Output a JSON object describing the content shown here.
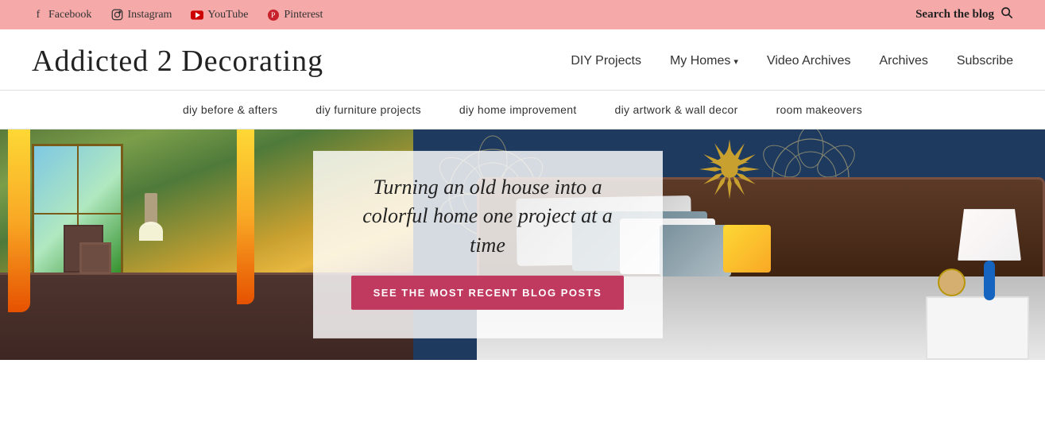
{
  "topbar": {
    "facebook": "Facebook",
    "instagram": "Instagram",
    "youtube": "YouTube",
    "pinterest": "Pinterest",
    "search_label": "Search the blog"
  },
  "header": {
    "logo": "Addicted 2 Decorating",
    "nav": [
      {
        "id": "diy-projects",
        "label": "DIY Projects",
        "has_dropdown": false
      },
      {
        "id": "my-homes",
        "label": "My Homes",
        "has_dropdown": true
      },
      {
        "id": "video-archives",
        "label": "Video Archives",
        "has_dropdown": false
      },
      {
        "id": "archives",
        "label": "Archives",
        "has_dropdown": false
      },
      {
        "id": "subscribe",
        "label": "Subscribe",
        "has_dropdown": false
      }
    ]
  },
  "subnav": [
    {
      "id": "before-afters",
      "label": "diy before & afters"
    },
    {
      "id": "furniture-projects",
      "label": "diy furniture projects"
    },
    {
      "id": "home-improvement",
      "label": "diy home improvement"
    },
    {
      "id": "artwork-wall-decor",
      "label": "diy artwork & wall decor"
    },
    {
      "id": "room-makeovers",
      "label": "room makeovers"
    }
  ],
  "hero": {
    "tagline": "Turning an old house into a colorful home one project at a time",
    "cta_label": "SEE THE MOST RECENT BLOG POSTS"
  }
}
